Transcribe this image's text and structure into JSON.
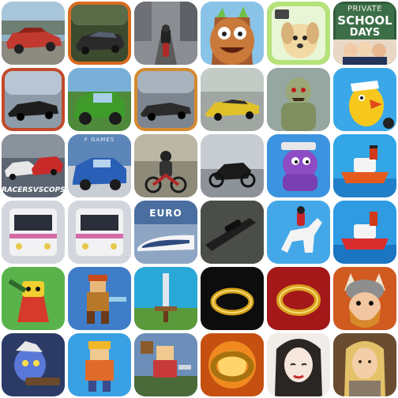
{
  "tiles": [
    {
      "name": "classic-car",
      "bg": "#7fa0b8"
    },
    {
      "name": "sports-car-drift",
      "bg": "#3c4a2e"
    },
    {
      "name": "motorbike-city",
      "bg": "#8a8d92"
    },
    {
      "name": "wooden-monster",
      "bg": "#8ac3e8"
    },
    {
      "name": "puppy",
      "bg": "#b5e27a"
    },
    {
      "name": "private-school-days",
      "bg": "#3c6f47",
      "text": {
        "line1": "PRIVATE",
        "line2": "SCHOOL",
        "line3": "DAYS"
      }
    },
    {
      "name": "red-frame-supercar",
      "bg": "#c24a2a"
    },
    {
      "name": "green-jeep",
      "bg": "#7ab0d8"
    },
    {
      "name": "muscle-car-road",
      "bg": "#7d8590"
    },
    {
      "name": "yellow-lambo",
      "bg": "#a0a7a3"
    },
    {
      "name": "zombie",
      "bg": "#95a7a0"
    },
    {
      "name": "pirate-parrot",
      "bg": "#3aa8e8"
    },
    {
      "name": "racers-vs-cops",
      "bg": "#5b6470",
      "text": {
        "label": "RACERSVSCOPS"
      }
    },
    {
      "name": "blue-pickup",
      "bg": "#5c86b8",
      "text": {
        "brand": "F GAMES"
      }
    },
    {
      "name": "dirt-bike-rider",
      "bg": "#8e8a7a"
    },
    {
      "name": "sport-bike",
      "bg": "#c7ccd2"
    },
    {
      "name": "purple-octopus",
      "bg": "#3c93e0"
    },
    {
      "name": "tugboat-blue",
      "bg": "#32a6e6"
    },
    {
      "name": "pink-train-1",
      "bg": "#d3d6dc"
    },
    {
      "name": "pink-train-2",
      "bg": "#d3d6dc"
    },
    {
      "name": "euro-bullet-train",
      "bg": "#4a6ea0",
      "text": {
        "brand": "EURO"
      }
    },
    {
      "name": "sniper-rifle",
      "bg": "#3a3a3a"
    },
    {
      "name": "horse-jump",
      "bg": "#44a8e8"
    },
    {
      "name": "tugboat-red",
      "bg": "#2e9be3"
    },
    {
      "name": "green-robot",
      "bg": "#5ab34a"
    },
    {
      "name": "pixel-warrior",
      "bg": "#3f7dc8"
    },
    {
      "name": "pixel-sword",
      "bg": "#2aa8d8"
    },
    {
      "name": "gold-ring-dark",
      "bg": "#0d0d0d"
    },
    {
      "name": "gold-ring-red",
      "bg": "#a4181a"
    },
    {
      "name": "viking",
      "bg": "#d05a20"
    },
    {
      "name": "blue-gunner",
      "bg": "#2c3a66"
    },
    {
      "name": "pixel-boy",
      "bg": "#3aa0e4"
    },
    {
      "name": "pixel-knight",
      "bg": "#6d8eb8"
    },
    {
      "name": "glowing-ring",
      "bg": "#c55010"
    },
    {
      "name": "white-lady",
      "bg": "#f0ece8"
    },
    {
      "name": "blonde-warrior",
      "bg": "#6a4c30"
    }
  ]
}
